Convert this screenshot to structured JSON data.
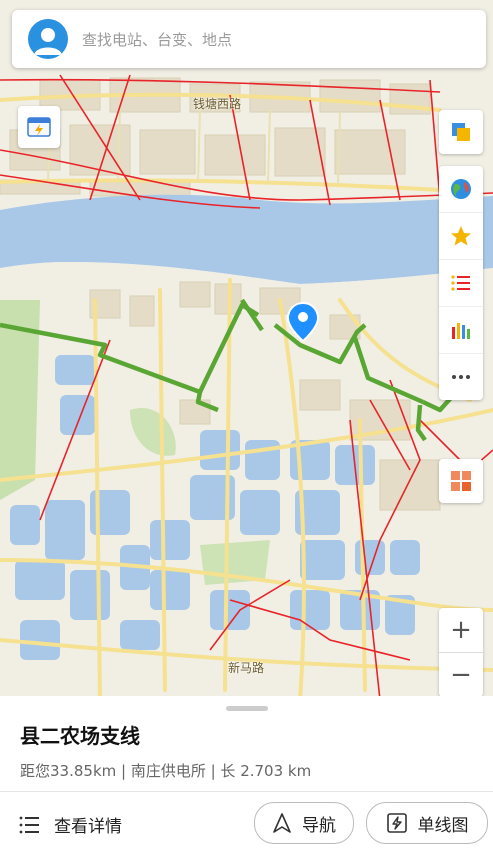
{
  "search": {
    "placeholder": "查找电站、台变、地点"
  },
  "map": {
    "road_labels": [
      "钱塘西路",
      "新马路"
    ],
    "colors": {
      "water": "#a9c8e8",
      "line_green": "#5aa634",
      "line_red": "#e8242a",
      "road": "#f5e190",
      "pin": "#1e90ff"
    }
  },
  "toolbar": {
    "icons": [
      "layers-icon",
      "globe-icon",
      "star-icon",
      "list-icon",
      "bar-chart-icon",
      "more-icon",
      "grid-icon"
    ],
    "zoom_in": "+",
    "zoom_out": "−"
  },
  "sheet": {
    "title": "县二农场支线",
    "subtitle": "距您33.85km | 南庄供电所 | 长 2.703 km",
    "detail_label": "查看详情",
    "nav_label": "导航",
    "diagram_label": "单线图"
  }
}
